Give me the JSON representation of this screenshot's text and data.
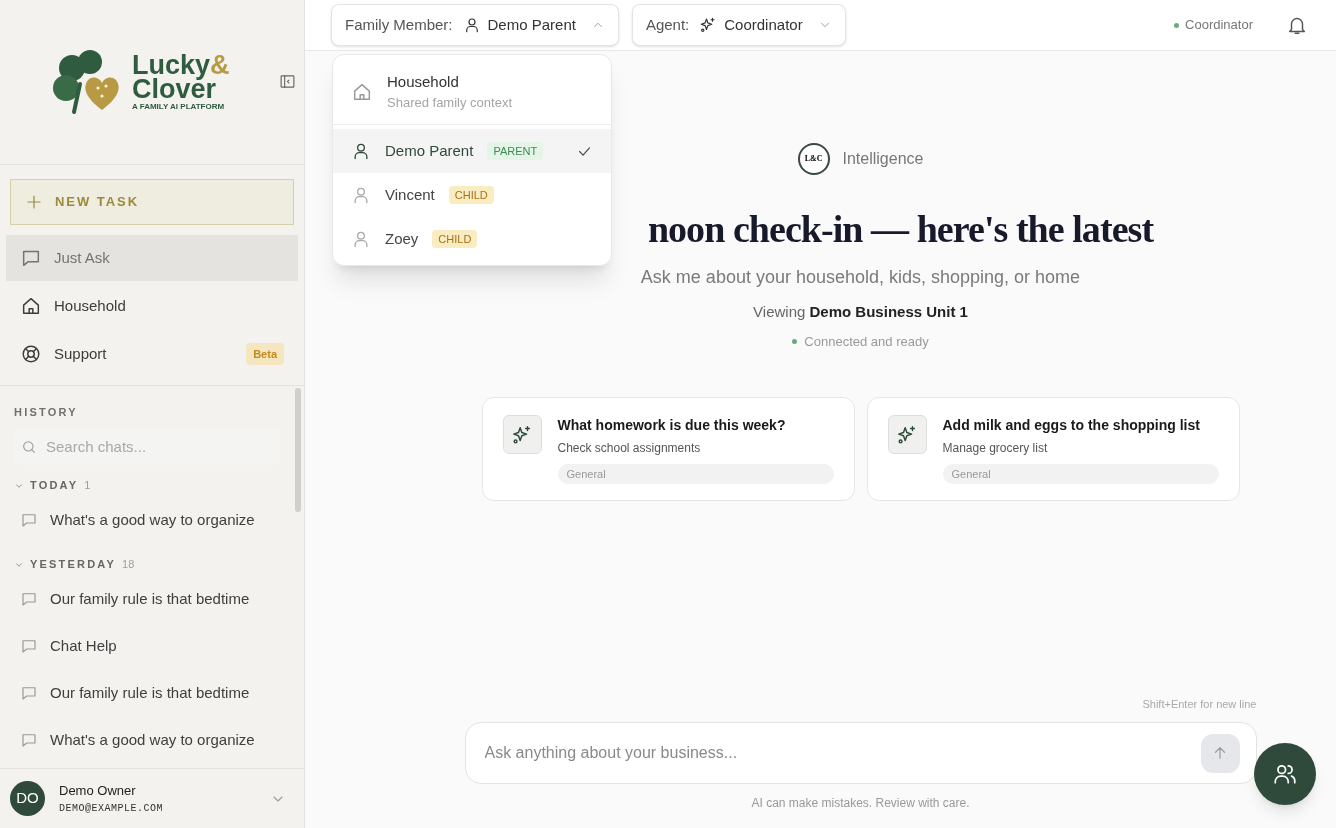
{
  "sidebar": {
    "logo": {
      "word1": "Lucky",
      "amp": "&",
      "word2": "Clover",
      "tagline": "A FAMILY AI PLATFORM"
    },
    "new_task": "NEW TASK",
    "nav": [
      {
        "label": "Just Ask",
        "selected": true
      },
      {
        "label": "Household",
        "selected": false
      },
      {
        "label": "Support",
        "selected": false,
        "badge": "Beta"
      }
    ],
    "history": {
      "title": "HISTORY",
      "search_placeholder": "Search chats...",
      "groups": [
        {
          "label": "TODAY",
          "count": "1",
          "expanded": true,
          "chats": [
            "What's a good way to organize"
          ]
        },
        {
          "label": "YESTERDAY",
          "count": "18",
          "expanded": true,
          "chats": [
            "Our family rule is that bedtime",
            "Chat Help",
            "Our family rule is that bedtime",
            "What's a good way to organize"
          ]
        }
      ]
    },
    "user": {
      "initials": "DO",
      "name": "Demo Owner",
      "email": "DEMO@EXAMPLE.COM"
    }
  },
  "header": {
    "family_member": {
      "label": "Family Member:",
      "value": "Demo Parent",
      "expanded": true
    },
    "agent": {
      "label": "Agent:",
      "value": "Coordinator",
      "expanded": false
    },
    "status": "Coordinator"
  },
  "member_menu": [
    {
      "kind": "household",
      "name": "Household",
      "subtitle": "Shared family context",
      "selected": false
    },
    {
      "kind": "parent",
      "name": "Demo Parent",
      "role": "PARENT",
      "selected": true
    },
    {
      "kind": "child",
      "name": "Vincent",
      "role": "CHILD",
      "selected": false
    },
    {
      "kind": "child",
      "name": "Zoey",
      "role": "CHILD",
      "selected": false
    }
  ],
  "main": {
    "brand_mark": "L&C",
    "brand": "Intelligence",
    "heading": "noon check-in — here's the latest",
    "subtitle": "Ask me about your household, kids, shopping, or home",
    "viewing": "Viewing **Demo Business Unit 1**",
    "connection": "Connected and ready",
    "suggestions": [
      {
        "title": "What homework is due this week?",
        "subtitle": "Check school assignments",
        "tag": "General"
      },
      {
        "title": "Add milk and eggs to the shopping list",
        "subtitle": "Manage grocery list",
        "tag": "General"
      }
    ],
    "composer": {
      "hint": "Shift+Enter for new line",
      "placeholder": "Ask anything about your business...",
      "disclaimer": "AI can make mistakes. Review with care."
    }
  }
}
